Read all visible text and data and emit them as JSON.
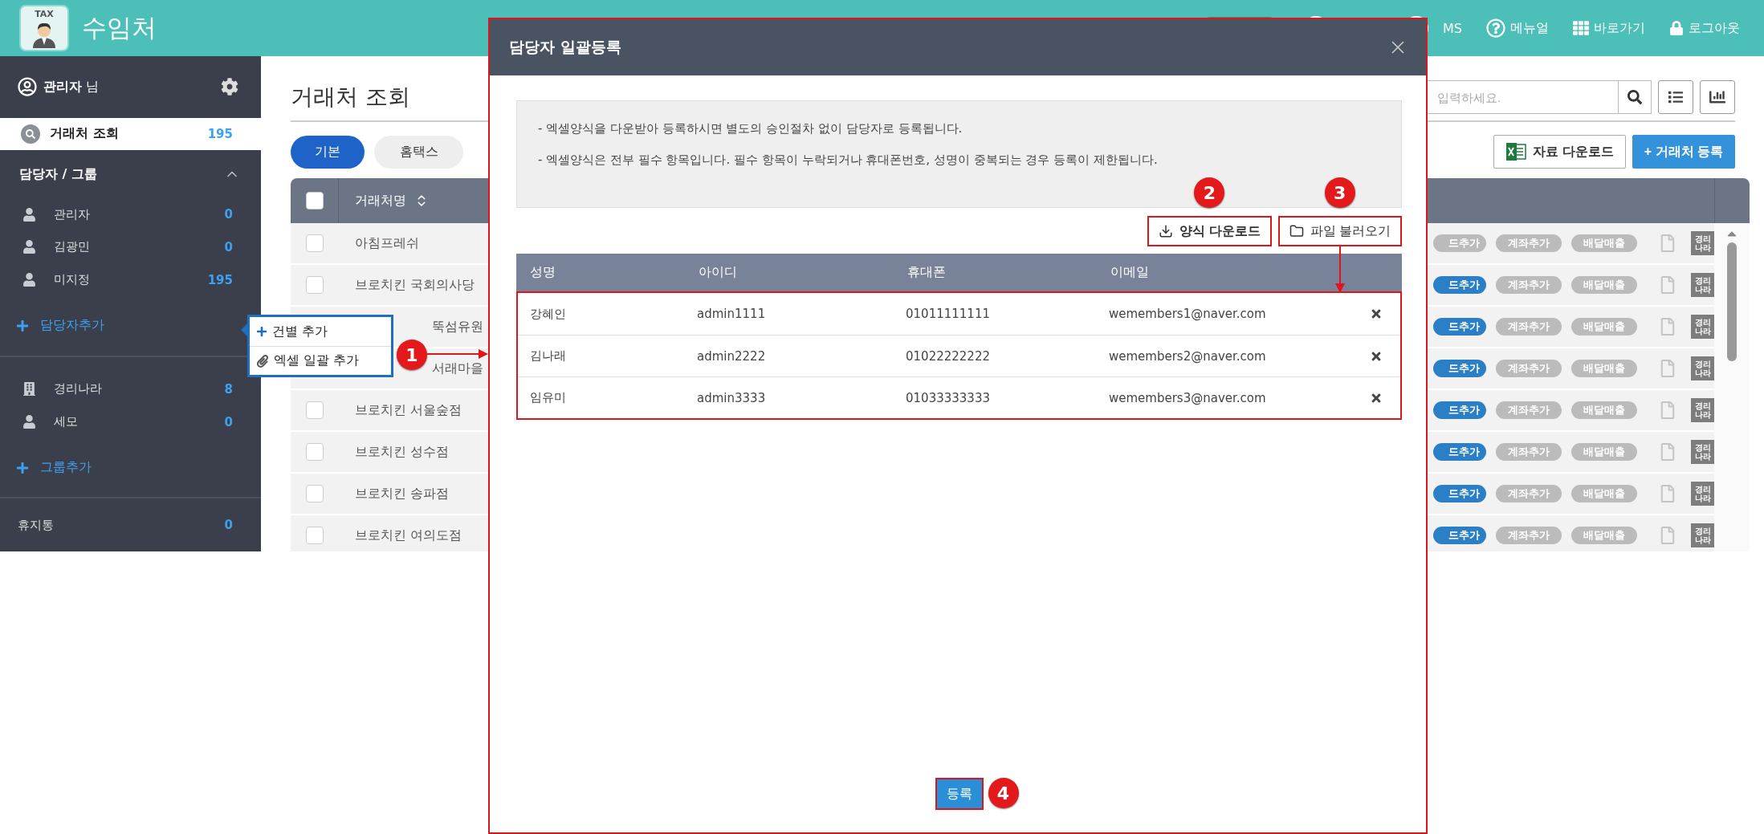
{
  "header": {
    "logo_text": "TAX",
    "title": "수임처",
    "links": [
      {
        "kind": "text",
        "label": "MS"
      },
      {
        "kind": "help",
        "label": "메뉴얼"
      },
      {
        "kind": "grid",
        "label": "바로가기"
      },
      {
        "kind": "lock",
        "label": "로그아웃"
      }
    ]
  },
  "sidebar": {
    "user": {
      "name": "관리자",
      "suffix": "님"
    },
    "nav": [
      {
        "label": "거래처 조회",
        "count": "195",
        "selected": true
      }
    ],
    "section": {
      "title": "담당자 / 그룹",
      "expanded": true
    },
    "managers": [
      {
        "kind": "person",
        "label": "관리자",
        "count": "0"
      },
      {
        "kind": "person",
        "label": "김광민",
        "count": "0"
      },
      {
        "kind": "person",
        "label": "미지정",
        "count": "195"
      }
    ],
    "add_manager": "담당자추가",
    "groups": [
      {
        "kind": "company",
        "label": "경리나라",
        "count": "8"
      },
      {
        "kind": "person",
        "label": "세모",
        "count": "0"
      }
    ],
    "add_group": "그룹추가",
    "trash": {
      "label": "휴지통",
      "count": "0"
    }
  },
  "popup_menu": {
    "items": [
      {
        "kind": "plus",
        "label": "건별 추가"
      },
      {
        "kind": "clip",
        "label": "엑셀 일괄 추가"
      }
    ],
    "callout": "1"
  },
  "main": {
    "title": "거래처 조회",
    "tabs": [
      {
        "label": "기본",
        "selected": true
      },
      {
        "label": "홈택스",
        "selected": false
      }
    ],
    "search": {
      "placeholder": "입력하세요."
    },
    "buttons": [
      {
        "kind": "excel",
        "label": "자료 다운로드"
      },
      {
        "kind": "primary",
        "label": "+ 거래처 등록"
      }
    ],
    "table": {
      "columns": [
        "거래처명"
      ],
      "select_all": {
        "checked": false
      },
      "rows": [
        {
          "name": "아침프레쉬",
          "checked": false,
          "card": {
            "label": "드추가",
            "active": false
          },
          "badges": [
            "계좌추가",
            "배달매출"
          ],
          "erp": "경리나라"
        },
        {
          "name": "브로치킨 국회의사당",
          "checked": false,
          "card": {
            "label": "드추가",
            "active": true
          },
          "badges": [
            "계좌추가",
            "배달매출"
          ],
          "erp": "경리나라"
        },
        {
          "name": "뚝섬유원",
          "covered": true,
          "card": {
            "label": "드추가",
            "active": true
          },
          "badges": [
            "계좌추가",
            "배달매출"
          ],
          "erp": "경리나라"
        },
        {
          "name": "서래마을",
          "covered": true,
          "card": {
            "label": "드추가",
            "active": true
          },
          "badges": [
            "계좌추가",
            "배달매출"
          ],
          "erp": "경리나라"
        },
        {
          "name": "브로치킨 서울숲점",
          "checked": false,
          "card": {
            "label": "드추가",
            "active": true
          },
          "badges": [
            "계좌추가",
            "배달매출"
          ],
          "erp": "경리나라"
        },
        {
          "name": "브로치킨 성수점",
          "checked": false,
          "card": {
            "label": "드추가",
            "active": true
          },
          "badges": [
            "계좌추가",
            "배달매출"
          ],
          "erp": "경리나라"
        },
        {
          "name": "브로치킨 송파점",
          "checked": false,
          "card": {
            "label": "드추가",
            "active": true
          },
          "badges": [
            "계좌추가",
            "배달매출"
          ],
          "erp": "경리나라"
        },
        {
          "name": "브로치킨 여의도점",
          "checked": false,
          "card": {
            "label": "드추가",
            "active": true
          },
          "badges": [
            "계좌추가",
            "배달매출"
          ],
          "erp": "경리나라"
        }
      ]
    }
  },
  "modal": {
    "title": "담당자 일괄등록",
    "notes": [
      "- 엑셀양식을 다운받아 등록하시면 별도의 승인절차 없이 담당자로 등록됩니다.",
      "- 엑셀양식은 전부 필수 항목입니다. 필수 항목이 누락되거나 휴대폰번호, 성명이 중복되는 경우 등록이 제한됩니다."
    ],
    "actions": [
      {
        "kind": "download",
        "label": "양식 다운로드",
        "callout": "2"
      },
      {
        "kind": "folder",
        "label": "파일 불러오기",
        "callout": "3"
      }
    ],
    "table": {
      "columns": [
        "성명",
        "아이디",
        "휴대폰",
        "이메일"
      ],
      "rows": [
        {
          "name": "강혜인",
          "id": "admin1111",
          "phone": "01011111111",
          "email": "wemembers1@naver.com"
        },
        {
          "name": "김나래",
          "id": "admin2222",
          "phone": "01022222222",
          "email": "wemembers2@naver.com"
        },
        {
          "name": "임유미",
          "id": "admin3333",
          "phone": "01033333333",
          "email": "wemembers3@naver.com"
        }
      ]
    },
    "submit": {
      "label": "등록",
      "callout": "4"
    }
  }
}
